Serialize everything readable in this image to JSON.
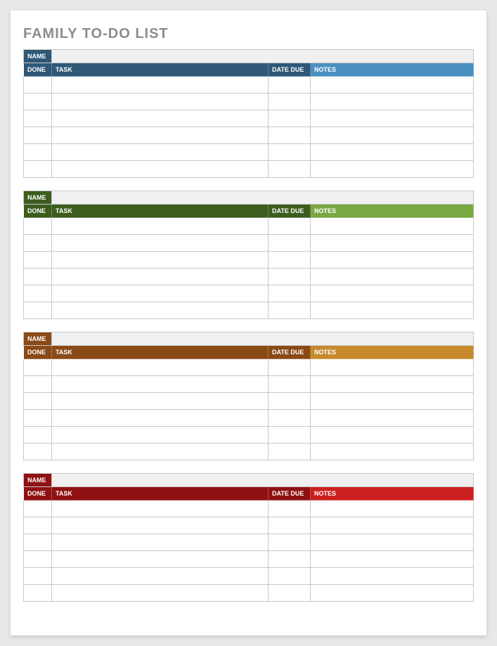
{
  "title": "FAMILY TO-DO LIST",
  "labels": {
    "name": "NAME",
    "done": "DONE",
    "task": "TASK",
    "date_due": "DATE DUE",
    "notes": "NOTES"
  },
  "sections": [
    {
      "color_scheme": "blue",
      "name_label_bg": "#2f5877",
      "header_left_bg": "#2f5877",
      "header_right_bg": "#4a90c0",
      "name_value": "",
      "rows": [
        {
          "done": "",
          "task": "",
          "date_due": "",
          "notes": ""
        },
        {
          "done": "",
          "task": "",
          "date_due": "",
          "notes": ""
        },
        {
          "done": "",
          "task": "",
          "date_due": "",
          "notes": ""
        },
        {
          "done": "",
          "task": "",
          "date_due": "",
          "notes": ""
        },
        {
          "done": "",
          "task": "",
          "date_due": "",
          "notes": ""
        },
        {
          "done": "",
          "task": "",
          "date_due": "",
          "notes": ""
        }
      ]
    },
    {
      "color_scheme": "green",
      "name_label_bg": "#3d5d1f",
      "header_left_bg": "#3d5d1f",
      "header_right_bg": "#7aa843",
      "name_value": "",
      "rows": [
        {
          "done": "",
          "task": "",
          "date_due": "",
          "notes": ""
        },
        {
          "done": "",
          "task": "",
          "date_due": "",
          "notes": ""
        },
        {
          "done": "",
          "task": "",
          "date_due": "",
          "notes": ""
        },
        {
          "done": "",
          "task": "",
          "date_due": "",
          "notes": ""
        },
        {
          "done": "",
          "task": "",
          "date_due": "",
          "notes": ""
        },
        {
          "done": "",
          "task": "",
          "date_due": "",
          "notes": ""
        }
      ]
    },
    {
      "color_scheme": "orange",
      "name_label_bg": "#8a4a16",
      "header_left_bg": "#8a4a16",
      "header_right_bg": "#c58a2c",
      "name_value": "",
      "rows": [
        {
          "done": "",
          "task": "",
          "date_due": "",
          "notes": ""
        },
        {
          "done": "",
          "task": "",
          "date_due": "",
          "notes": ""
        },
        {
          "done": "",
          "task": "",
          "date_due": "",
          "notes": ""
        },
        {
          "done": "",
          "task": "",
          "date_due": "",
          "notes": ""
        },
        {
          "done": "",
          "task": "",
          "date_due": "",
          "notes": ""
        },
        {
          "done": "",
          "task": "",
          "date_due": "",
          "notes": ""
        }
      ]
    },
    {
      "color_scheme": "red",
      "name_label_bg": "#8f1111",
      "header_left_bg": "#8f1111",
      "header_right_bg": "#cc1f1f",
      "name_value": "",
      "rows": [
        {
          "done": "",
          "task": "",
          "date_due": "",
          "notes": ""
        },
        {
          "done": "",
          "task": "",
          "date_due": "",
          "notes": ""
        },
        {
          "done": "",
          "task": "",
          "date_due": "",
          "notes": ""
        },
        {
          "done": "",
          "task": "",
          "date_due": "",
          "notes": ""
        },
        {
          "done": "",
          "task": "",
          "date_due": "",
          "notes": ""
        },
        {
          "done": "",
          "task": "",
          "date_due": "",
          "notes": ""
        }
      ]
    }
  ]
}
